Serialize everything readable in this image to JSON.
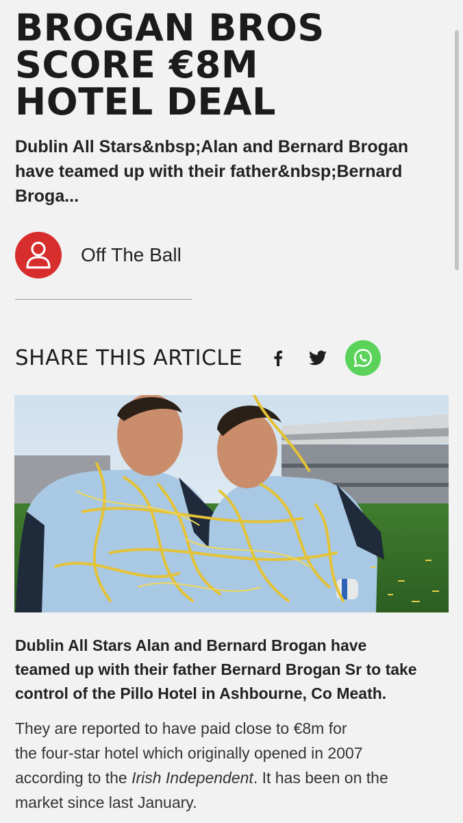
{
  "article": {
    "headline_lines": [
      "BROGAN BROS",
      "SCORE €8M",
      "HOTEL DEAL"
    ],
    "standfirst_lines": [
      "Dublin All Stars&nbsp;Alan and Bernard Brogan",
      "have teamed up with their father&nbsp;Bernard",
      "Broga..."
    ],
    "author": {
      "name": "Off The Ball",
      "icon": "user-icon",
      "avatar_color": "#d72d2d"
    },
    "share": {
      "title": "SHARE THIS ARTICLE",
      "buttons": [
        {
          "icon": "facebook-icon"
        },
        {
          "icon": "twitter-icon"
        },
        {
          "icon": "whatsapp-icon",
          "color": "#5bd35b"
        }
      ]
    },
    "lead_lines": [
      "Dublin All Stars Alan and Bernard Brogan have",
      "teamed up with their father Bernard Brogan Sr to take",
      "control of the Pillo Hotel in Ashbourne, Co Meath."
    ],
    "body": {
      "line1": "They are reported to have paid close to €8m for",
      "line2": "the four-star hotel which originally opened in 2007",
      "line3_pre": "according to the ",
      "line3_em": "Irish Independent",
      "line3_post": ". It has been on the",
      "line4": "market since last January."
    }
  },
  "colors": {
    "background": "#f2f2f2",
    "text": "#1e1e1e",
    "accent_red": "#d72d2d",
    "whatsapp_green": "#5bd35b"
  }
}
